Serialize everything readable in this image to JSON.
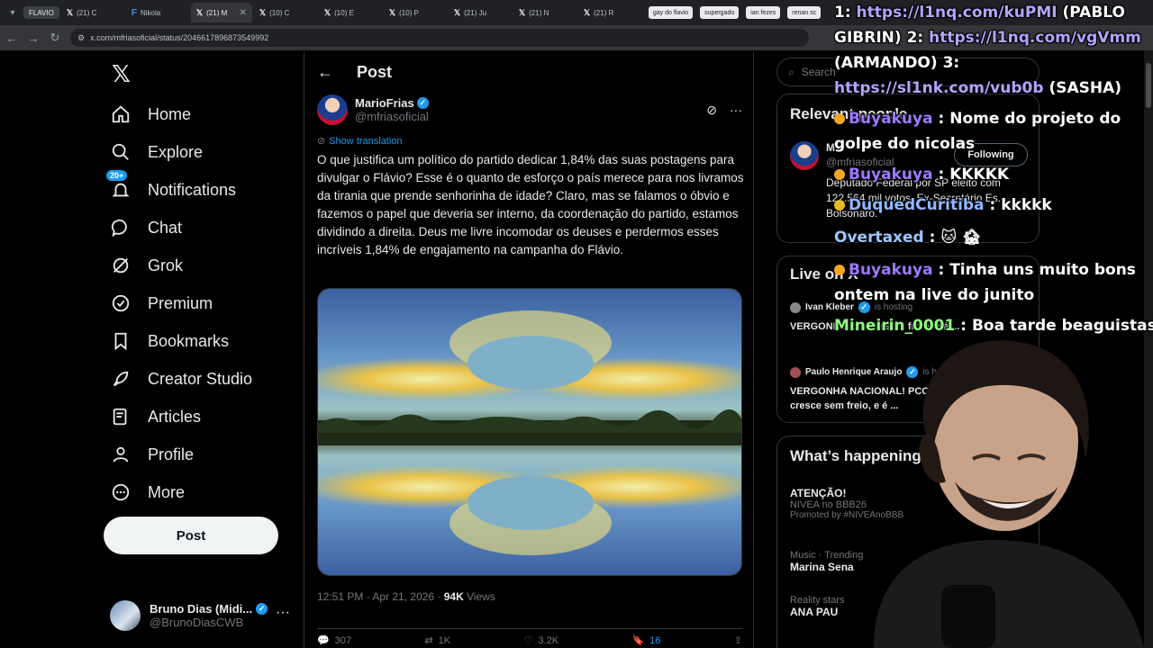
{
  "browser": {
    "tabs": [
      {
        "label": "FLAVIO",
        "type": "pill"
      },
      {
        "label": "(21) C",
        "icon": "x"
      },
      {
        "label": "Nikola",
        "icon": "f"
      },
      {
        "label": "(21) M",
        "icon": "x",
        "active": true
      },
      {
        "label": "(10) C",
        "icon": "x"
      },
      {
        "label": "(10) E",
        "icon": "x"
      },
      {
        "label": "(10) P",
        "icon": "x"
      },
      {
        "label": "(21) Ju",
        "icon": "x"
      },
      {
        "label": "(21) N",
        "icon": "x"
      },
      {
        "label": "(21) R",
        "icon": "x"
      }
    ],
    "bookmarks": [
      "gay do flavio",
      "supergado",
      "ian fezes",
      "renan sc"
    ],
    "url": "x.com/mfriasoficial/status/2046617896873549992"
  },
  "nav": {
    "items": [
      {
        "label": "Home",
        "icon": "home-icon"
      },
      {
        "label": "Explore",
        "icon": "search-icon"
      },
      {
        "label": "Notifications",
        "icon": "bell-icon",
        "badge": "20+"
      },
      {
        "label": "Chat",
        "icon": "chat-icon"
      },
      {
        "label": "Grok",
        "icon": "grok-icon"
      },
      {
        "label": "Premium",
        "icon": "premium-icon"
      },
      {
        "label": "Bookmarks",
        "icon": "bookmark-icon"
      },
      {
        "label": "Creator Studio",
        "icon": "rocket-icon"
      },
      {
        "label": "Articles",
        "icon": "articles-icon"
      },
      {
        "label": "Profile",
        "icon": "person-icon"
      },
      {
        "label": "More",
        "icon": "more-icon"
      }
    ],
    "post_label": "Post",
    "profile": {
      "name": "Bruno Dias (Midi...",
      "handle": "@BrunoDiasCWB"
    }
  },
  "post": {
    "header_title": "Post",
    "author_name": "MarioFrias",
    "author_handle": "@mfriasoficial",
    "show_translation": "Show translation",
    "text": "O que justifica um político do partido dedicar 1,84% das suas postagens para divulgar o Flávio? Esse é o quanto de esforço o país merece para nos livramos da tirania que prende senhorinha de idade? Claro, mas se falamos o óbvio e fazemos o papel que deveria ser interno, da coordenação do partido, estamos dividindo a direita. Deus me livre incomodar os deuses e perdermos esses incríveis 1,84% de engajamento na campanha do Flávio.",
    "time": "12:51 PM · Apr 21, 2026 · ",
    "views": "94K",
    "views_label": " Views",
    "stats": {
      "replies": "307",
      "reposts": "1K",
      "likes": "3.2K",
      "bookmarks": "16"
    }
  },
  "sidebar": {
    "search_placeholder": "Search",
    "relevant_title": "Relevant people",
    "relevant_name": "M",
    "relevant_handle": "@mfriasoficial",
    "following_label": "Following",
    "bio": "Deputado Federal por SP eleito com 122.564 mil votos. Ex-Secretário Es... Bolsonaro.",
    "live_title": "Live on X",
    "live": [
      {
        "name": "Ivan Kleber",
        "status": "is hosting",
        "text": "VERGONH... cresce sem freio, e é ..."
      },
      {
        "name": "Paulo Henrique Araujo",
        "status": "is hos",
        "text": "VERGONHA NACIONAL! PCC cresce sem freio, e é ..."
      }
    ],
    "happening_title": "What’s happening",
    "trends": [
      {
        "meta": "",
        "name": "ATENÇÃO!",
        "sub": "NIVEA no BBB26",
        "promo": "Promoted by #NIVEAnoBBB"
      },
      {
        "meta": "Music · Trending",
        "name": "Marina Sena"
      },
      {
        "meta": "Reality stars",
        "name": "ANA PAU"
      }
    ]
  },
  "overlay": {
    "links_line1_prefix": "1: ",
    "link1": "https://l1nq.com/kuPMI",
    "links_line1_suffix": " (PABLO",
    "links_line2_prefix": "GIBRIN) 2: ",
    "link2": "https://l1nq.com/vgVmm",
    "links_line3": "(ARMANDO) 3:",
    "link3": "https://sl1nk.com/vub0b",
    "links_line4_suffix": " (SASHA)",
    "messages": [
      {
        "user": "Buyakuya",
        "text": " : Nome do projeto do",
        "cont": "golpe do nicolas"
      },
      {
        "user": "Buyakuya",
        "text": " : KKKKK"
      },
      {
        "user": "DuquedCuritiba",
        "text": " : kkkkk"
      },
      {
        "user": "Overtaxed",
        "text": " :"
      },
      {
        "user": "Buyakuya",
        "text": " : Tinha uns muito bons",
        "cont": "ontem na live do junito"
      },
      {
        "user": "Mineirin_0001",
        "text": " : Boa tarde beaguistas!"
      }
    ]
  },
  "colors": {
    "accent": "#1d9bf0",
    "bg": "#000000",
    "border": "#2f3336",
    "muted": "#71767b"
  }
}
